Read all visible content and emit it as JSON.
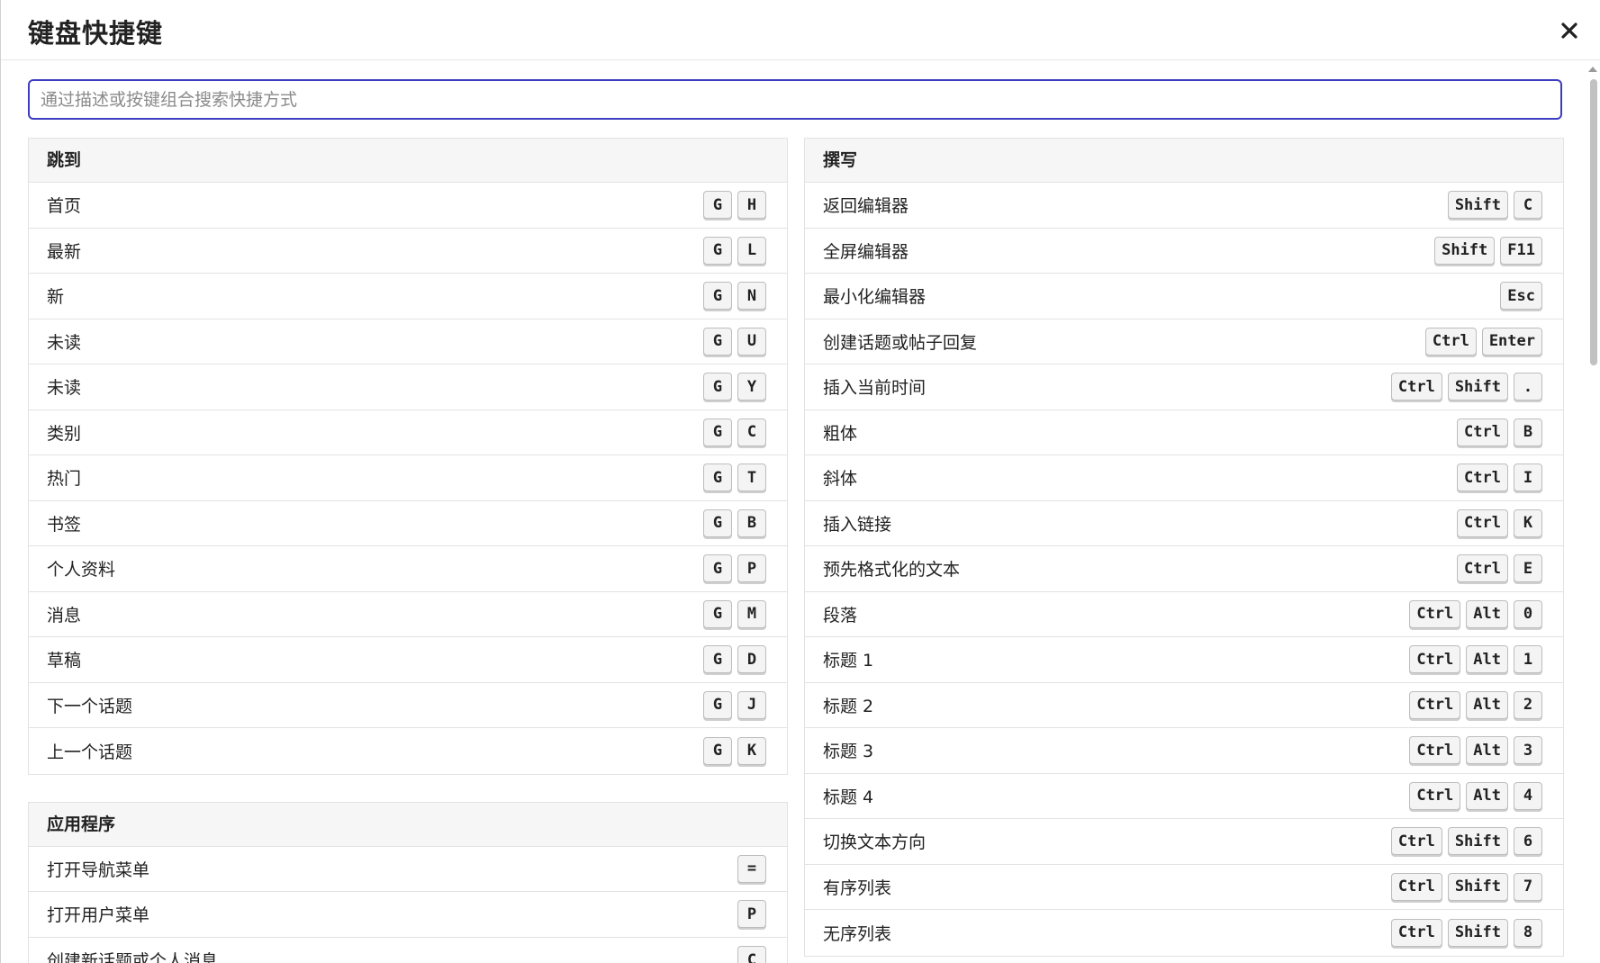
{
  "modal": {
    "title": "键盘快捷键"
  },
  "search": {
    "placeholder": "通过描述或按键组合搜索快捷方式"
  },
  "groups": {
    "jump": {
      "title": "跳到",
      "items": [
        {
          "label": "首页",
          "keys": [
            "G",
            "H"
          ]
        },
        {
          "label": "最新",
          "keys": [
            "G",
            "L"
          ]
        },
        {
          "label": "新",
          "keys": [
            "G",
            "N"
          ]
        },
        {
          "label": "未读",
          "keys": [
            "G",
            "U"
          ]
        },
        {
          "label": "未读",
          "keys": [
            "G",
            "Y"
          ]
        },
        {
          "label": "类别",
          "keys": [
            "G",
            "C"
          ]
        },
        {
          "label": "热门",
          "keys": [
            "G",
            "T"
          ]
        },
        {
          "label": "书签",
          "keys": [
            "G",
            "B"
          ]
        },
        {
          "label": "个人资料",
          "keys": [
            "G",
            "P"
          ]
        },
        {
          "label": "消息",
          "keys": [
            "G",
            "M"
          ]
        },
        {
          "label": "草稿",
          "keys": [
            "G",
            "D"
          ]
        },
        {
          "label": "下一个话题",
          "keys": [
            "G",
            "J"
          ]
        },
        {
          "label": "上一个话题",
          "keys": [
            "G",
            "K"
          ]
        }
      ]
    },
    "application": {
      "title": "应用程序",
      "items": [
        {
          "label": "打开导航菜单",
          "keys": [
            "="
          ]
        },
        {
          "label": "打开用户菜单",
          "keys": [
            "P"
          ]
        },
        {
          "label": "创建新话题或个人消息",
          "keys": [
            "C"
          ]
        }
      ]
    },
    "compose": {
      "title": "撰写",
      "items": [
        {
          "label": "返回编辑器",
          "keys": [
            "Shift",
            "C"
          ]
        },
        {
          "label": "全屏编辑器",
          "keys": [
            "Shift",
            "F11"
          ]
        },
        {
          "label": "最小化编辑器",
          "keys": [
            "Esc"
          ]
        },
        {
          "label": "创建话题或帖子回复",
          "keys": [
            "Ctrl",
            "Enter"
          ]
        },
        {
          "label": "插入当前时间",
          "keys": [
            "Ctrl",
            "Shift",
            "."
          ]
        },
        {
          "label": "粗体",
          "keys": [
            "Ctrl",
            "B"
          ]
        },
        {
          "label": "斜体",
          "keys": [
            "Ctrl",
            "I"
          ]
        },
        {
          "label": "插入链接",
          "keys": [
            "Ctrl",
            "K"
          ]
        },
        {
          "label": "预先格式化的文本",
          "keys": [
            "Ctrl",
            "E"
          ]
        },
        {
          "label": "段落",
          "keys": [
            "Ctrl",
            "Alt",
            "0"
          ]
        },
        {
          "label": "标题 1",
          "keys": [
            "Ctrl",
            "Alt",
            "1"
          ]
        },
        {
          "label": "标题 2",
          "keys": [
            "Ctrl",
            "Alt",
            "2"
          ]
        },
        {
          "label": "标题 3",
          "keys": [
            "Ctrl",
            "Alt",
            "3"
          ]
        },
        {
          "label": "标题 4",
          "keys": [
            "Ctrl",
            "Alt",
            "4"
          ]
        },
        {
          "label": "切换文本方向",
          "keys": [
            "Ctrl",
            "Shift",
            "6"
          ]
        },
        {
          "label": "有序列表",
          "keys": [
            "Ctrl",
            "Shift",
            "7"
          ]
        },
        {
          "label": "无序列表",
          "keys": [
            "Ctrl",
            "Shift",
            "8"
          ]
        }
      ]
    }
  },
  "icons": {
    "close": "close-icon"
  },
  "colors": {
    "search_focus_border": "#3d3dbf",
    "group_header_bg": "#f6f6f6",
    "kbd_bg": "#f4f4f4"
  }
}
